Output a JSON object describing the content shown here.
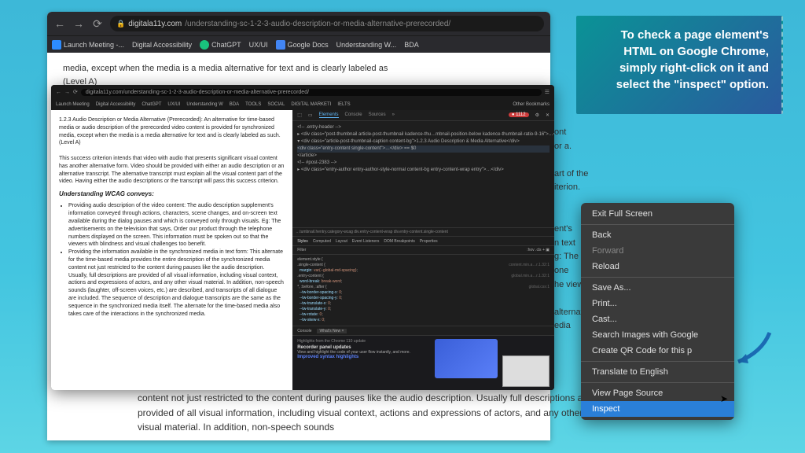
{
  "callout": "To check a page element's HTML on Google Chrome, simply right-click on it and select the \"inspect\" option.",
  "browser": {
    "url_host": "digitala11y.com",
    "url_path": "/understanding-sc-1-2-3-audio-description-or-media-alternative-prerecorded/",
    "bookmarks": [
      "Launch Meeting -...",
      "Digital Accessibility",
      "ChatGPT",
      "UX/UI",
      "Google Docs",
      "Understanding W...",
      "BDA"
    ],
    "bg_text1": "media, except when the media is a media alternative for text and is clearly labeled as",
    "bg_text2": "(Level A)"
  },
  "behind": {
    "l1": "ont",
    "l2": "or a.",
    "l3": "art of the",
    "l4": "iterion.",
    "l5": "ent's",
    "l6": "n text",
    "l7": "g: The",
    "l8": "one",
    "l9": "he viewer",
    "l10": "alternate",
    "l11": "edia"
  },
  "inner": {
    "url": "digitala11y.com/understanding-sc-1-2-3-audio-description-or-media-alternative-prerecorded/",
    "bm": [
      "Launch Meeting",
      "Digital Accessibility",
      "ChatGPT",
      "UX/UI",
      "Understanding W",
      "BDA",
      "TOOLS",
      "SOCIAL",
      "DIGITAL MARKETI",
      "IELTS",
      "Other Bookmarks"
    ],
    "p1": "1.2.3 Audio Description or Media Alternative (Prerecorded): An alternative for time-based media or audio description of the prerecorded video content is provided for synchronized media, except when the media is a media alternative for text and is clearly labeled as such. (Level A)",
    "p2": "This success criterion intends that video with audio that presents significant visual content has another alternative form. Video should be provided with either an audio description or an alternative transcript. The alternative transcript must explain all the visual content part of the video. Having either the audio descriptions or the transcript will pass this success criterion.",
    "h": "Understanding WCAG conveys:",
    "li1": "Providing audio description of the video content: The audio description supplement's information conveyed through actions, characters, scene changes, and on-screen text available during the dialog pauses and which is conveyed only through visuals. Eg: The advertisements on the television that says, Order our product through the telephone numbers displayed on the screen. This information must be spoken out so that the viewers with blindness and visual challenges too benefit.",
    "li2": "Providing the information available in the synchronized media in text form: This alternate for the time-based media provides the entire description of the synchronized media content not just restricted to the content during pauses like the audio description. Usually, full descriptions are provided of all visual information, including visual context, actions and expressions of actors, and any other visual material. In addition, non-speech sounds (laughter, off-screen voices, etc.) are described, and transcripts of all dialogue are included. The sequence of description and dialogue transcripts are the same as the sequence in the synchronized media itself. The alternate for the time-based media also takes care of the interactions in the synchronized media."
  },
  "dev": {
    "tabs": [
      "Elements",
      "Console",
      "Sources",
      "»"
    ],
    "badge": "● 1112",
    "dom_lines": [
      "<!-- .entry-header -->",
      "▸ <div class=\"post-thumbnail article-post-thumbnail kadence-thu…mbnail-position-below kadence-thumbnail-ratio-9-16\">…</div>",
      "▾ <div class=\"article-post-thumbnail-caption content-bg\">1.2.3 Audio Description & Media Alternative</div>",
      "<div class=\"entry-content single-content\">…</div> == $0",
      "</article>",
      "<!-- #post-2383 -->",
      "▸ <div class=\"entry-author entry-author-style-normal content-bg entry-content-wrap entry\">…</div>"
    ],
    "crumb": "…tumbnail.hentry.category-wcag div.entry-content-wrap div.entry-content.single-content",
    "styles_tabs": [
      "Styles",
      "Computed",
      "Layout",
      "Event Listeners",
      "DOM Breakpoints",
      "Properties",
      "»"
    ],
    "filter": "Filter",
    "hov": ":hov .cls + ▣",
    "rules": [
      {
        "sel": "element.style {",
        "src": ""
      },
      {
        "sel": ".single-content {",
        "src": "content.min.a…r.1.32:1"
      },
      {
        "p": "margin",
        "v": "var(--global-md-spacing)"
      },
      {
        "sel": ".entry-content {",
        "src": "global.min.a…r.1.32:1"
      },
      {
        "p": "word-break",
        "v": "break-word"
      },
      {
        "sel": "*, :before, :after {",
        "src": "global.css:1"
      },
      {
        "p": "--tw-border-spacing-x",
        "v": "0"
      },
      {
        "p": "--tw-border-spacing-y",
        "v": "0"
      },
      {
        "p": "--tw-translate-x",
        "v": "0"
      },
      {
        "p": "--tw-translate-y",
        "v": "0"
      },
      {
        "p": "--tw-rotate",
        "v": "0"
      },
      {
        "p": "--tw-skew-x",
        "v": "0"
      }
    ],
    "promo_tab1": "Console",
    "promo_tab2": "What's New ×",
    "promo_title": "Highlights from the Chrome 110 update",
    "promo_h1": "Recorder panel updates",
    "promo_p1": "View and highlight the code of your user flow instantly, and more.",
    "promo_h2": "Improved syntax highlights"
  },
  "ctx": {
    "items": [
      {
        "label": "Exit Full Screen",
        "dis": false
      },
      {
        "sep": true
      },
      {
        "label": "Back",
        "dis": false
      },
      {
        "label": "Forward",
        "dis": true
      },
      {
        "label": "Reload",
        "dis": false
      },
      {
        "sep": true
      },
      {
        "label": "Save As...",
        "dis": false
      },
      {
        "label": "Print...",
        "dis": false
      },
      {
        "label": "Cast...",
        "dis": false
      },
      {
        "label": "Search Images with Google",
        "dis": false
      },
      {
        "label": "Create QR Code for this p",
        "dis": false
      },
      {
        "sep": true
      },
      {
        "label": "Translate to English",
        "dis": false
      },
      {
        "sep": true
      },
      {
        "label": "View Page Source",
        "dis": false
      },
      {
        "label": "Inspect",
        "dis": false,
        "hl": true
      }
    ]
  },
  "bottom": "content not just restricted to the content during pauses like the audio description. Usually full descriptions are provided of all visual information, including visual context, actions and expressions of actors, and any other visual material. In addition, non-speech sounds"
}
